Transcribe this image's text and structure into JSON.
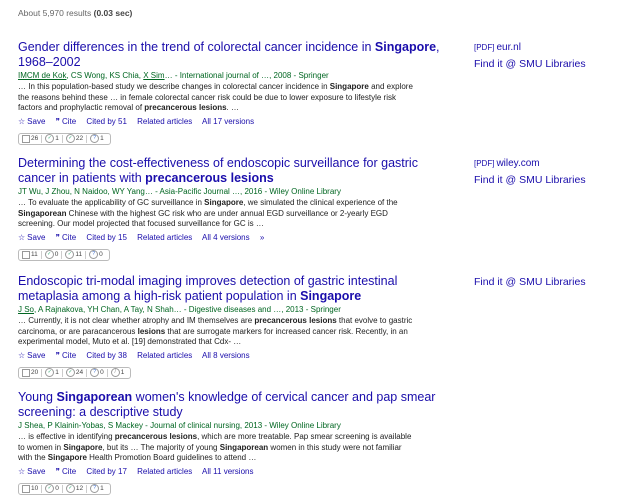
{
  "stats": {
    "prefix": "About 5,970 results",
    "time": "(0.03 sec)"
  },
  "results": [
    {
      "title_a": "Gender differences in the trend of colorectal cancer incidence in ",
      "title_b": "Singapore",
      "title_c": ", 1968–2002",
      "authors_a": "IMCM de Kok",
      "authors_b": ", CS Wong, KS Chia, ",
      "authors_c": "X Sim",
      "authors_d": "… - International journal of …, 2008 - Springer",
      "snippet_a": "… In this population-based study we describe changes in colorectal cancer incidence in ",
      "snippet_b": "Singapore",
      "snippet_c": " and explore the reasons behind these … in female colorectal cancer risk could be due to lower exposure to lifestyle risk factors and prophylactic removal of ",
      "snippet_d": "precancerous lesions",
      "snippet_e": ". …",
      "save": "Save",
      "cite": "Cite",
      "cited": "Cited by 51",
      "related": "Related articles",
      "versions": "All 17 versions",
      "chips": [
        "26",
        "1",
        "22",
        "1"
      ],
      "side_pdf_tag": "[PDF]",
      "side_pdf": "eur.nl",
      "side_lib": "Find it @ SMU Libraries"
    },
    {
      "title_a": "Determining the cost-effectiveness of endoscopic surveillance for gastric cancer in patients with ",
      "title_b": "precancerous lesions",
      "authors": "JT Wu, J Zhou, N Naidoo, WY Yang… - Asia-Pacific Journal …, 2016 - Wiley Online Library",
      "snippet_a": "… To evaluate the applicability of GC surveillance in ",
      "snippet_b": "Singapore",
      "snippet_c": ", we simulated the clinical experience of the ",
      "snippet_d": "Singaporean",
      "snippet_e": " Chinese with the highest GC risk who are under annual EGD surveillance or 2-yearly EGD screening. Our model projected that focused surveillance for GC is …",
      "save": "Save",
      "cite": "Cite",
      "cited": "Cited by 15",
      "related": "Related articles",
      "versions": "All 4 versions",
      "more": "»",
      "chips": [
        "11",
        "0",
        "11",
        "0"
      ],
      "side_pdf_tag": "[PDF]",
      "side_pdf": "wiley.com",
      "side_lib": "Find it @ SMU Libraries"
    },
    {
      "title_a": "Endoscopic tri-modal imaging improves detection of gastric intestinal metaplasia among a high-risk patient population in ",
      "title_b": "Singapore",
      "authors_a": "J So",
      "authors_b": ", A Rajnakova, YH Chan, A Tay, N Shah… - Digestive diseases and …, 2013 - Springer",
      "snippet_a": "… Currently, it is not clear whether atrophy and IM themselves are ",
      "snippet_b": "precancerous lesions",
      "snippet_c": " that evolve to gastric carcinoma, or are paracancerous ",
      "snippet_d": "lesions",
      "snippet_e": " that are surrogate markers for increased cancer risk. Recently, in an experimental model, Muto et al. [19] demonstrated that Cdx- …",
      "save": "Save",
      "cite": "Cite",
      "cited": "Cited by 38",
      "related": "Related articles",
      "versions": "All 8 versions",
      "chips": [
        "20",
        "1",
        "24",
        "0",
        "1"
      ],
      "side_lib": "Find it @ SMU Libraries"
    },
    {
      "title_a": "Young ",
      "title_b": "Singaporean",
      "title_c": " women's knowledge of cervical cancer and pap smear screening: a descriptive study",
      "authors": "J Shea, P Klainin-Yobas, S Mackey - Journal of clinical nursing, 2013 - Wiley Online Library",
      "snippet_a": "… is effective in identifying ",
      "snippet_b": "precancerous lesions",
      "snippet_c": ", which are more treatable. Pap smear screening is available to women in ",
      "snippet_d": "Singapore",
      "snippet_e": ", but its … The majority of young ",
      "snippet_f": "Singaporean",
      "snippet_g": " women in this study were not familiar with the ",
      "snippet_h": "Singapore",
      "snippet_i": " Health Promotion Board guidelines to attend …",
      "save": "Save",
      "cite": "Cite",
      "cited": "Cited by 17",
      "related": "Related articles",
      "versions": "All 11 versions",
      "chips": [
        "10",
        "0",
        "12",
        "1"
      ]
    }
  ]
}
